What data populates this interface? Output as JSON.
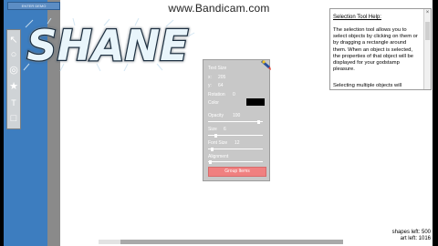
{
  "watermark": "www.Bandicam.com",
  "top_button_label": "ENTER DEMO",
  "logo_text": "SHANE",
  "toolbar": {
    "tools": [
      {
        "name": "cursor-tool-icon",
        "glyph": "↖"
      },
      {
        "name": "ellipse-tool-icon",
        "glyph": "○"
      },
      {
        "name": "circle-tool-icon",
        "glyph": "◎"
      },
      {
        "name": "star-tool-icon",
        "glyph": "★"
      },
      {
        "name": "text-tool-icon",
        "glyph": "T"
      },
      {
        "name": "rect-tool-icon",
        "glyph": "□"
      }
    ]
  },
  "panel": {
    "row1_label": "Text Size",
    "x_label": "x:",
    "x_value": "205",
    "y_label": "y:",
    "y_value": "64",
    "rotation_label": "Rotation",
    "rotation_value": "0",
    "color_label": "Color",
    "color_value": "#000000",
    "opacity_label": "Opacity",
    "opacity_value": "100",
    "size_label": "Size",
    "size_value": "6",
    "font_label": "Font Size",
    "font_value": "12",
    "align_label": "Alignment",
    "group_button": "Group Items",
    "sliders": {
      "opacity": 0.95,
      "size": 0.12,
      "font": 0.05,
      "align": 0.02
    }
  },
  "help": {
    "title": "Selection Tool Help:",
    "body": "The selection tool allows you to select objects by clicking on them or by dragging a rectangle around them.  When an object is selected, the properties of that object will be displayed for your godstamp pleasure.",
    "more": "Selecting multiple objects will"
  },
  "stats": {
    "shapes_left": "shapes left: 500",
    "art_left": "art left: 1016"
  },
  "colors": {
    "left_panel": "#3d7dbf",
    "group_button": "#f08080"
  }
}
